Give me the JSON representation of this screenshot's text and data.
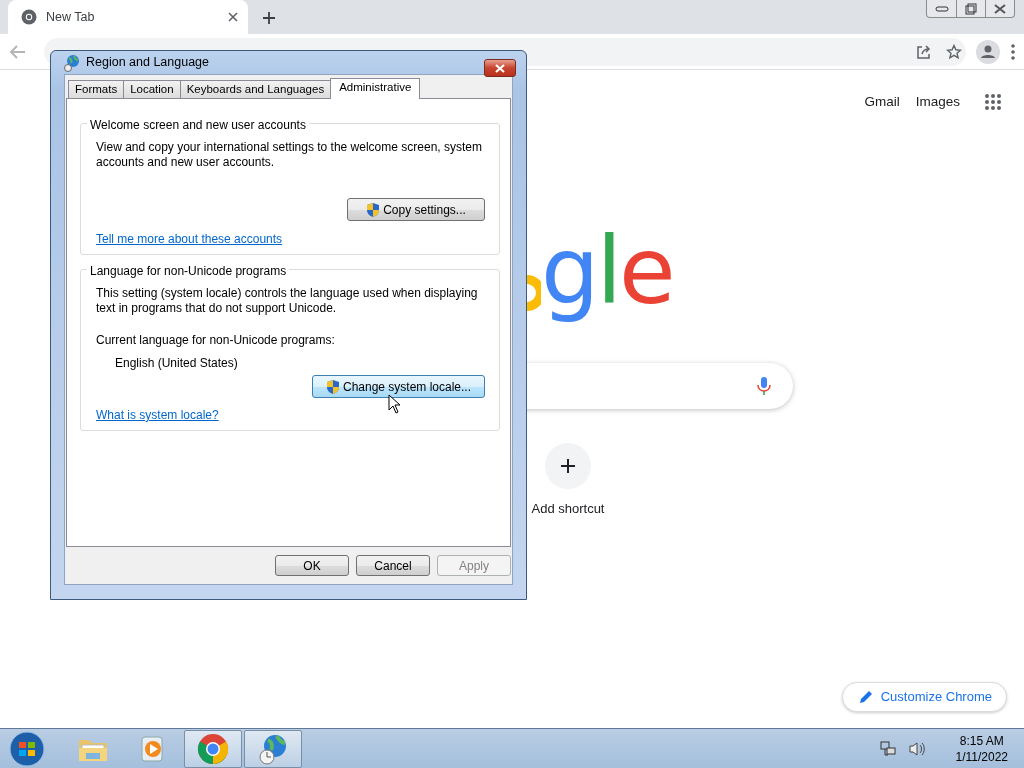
{
  "browser": {
    "tabs": [
      {
        "title": "New Tab",
        "selected": true
      }
    ],
    "top_links": [
      "Gmail",
      "Images"
    ],
    "logo_text": "gle",
    "shortcut": {
      "label": "Add shortcut"
    },
    "customize_button": "Customize Chrome"
  },
  "dialog": {
    "title": "Region and Language",
    "tabs": [
      {
        "label": "Formats",
        "selected": false
      },
      {
        "label": "Location",
        "selected": false
      },
      {
        "label": "Keyboards and Languages",
        "selected": false
      },
      {
        "label": "Administrative",
        "selected": true
      }
    ],
    "groups": [
      {
        "title": "Welcome screen and new user accounts",
        "description": "View and copy your international settings to the welcome screen, system accounts and new user accounts.",
        "button": {
          "label": "Copy settings...",
          "highlighted": false
        },
        "link": "Tell me more about these accounts"
      },
      {
        "title": "Language for non-Unicode programs",
        "description": "This setting (system locale) controls the language used when displaying text in programs that do not support Unicode.",
        "current_label": "Current language for non-Unicode programs:",
        "current_value": "English (United States)",
        "button": {
          "label": "Change system locale...",
          "highlighted": true
        },
        "link": "What is system locale?"
      }
    ],
    "buttons": [
      {
        "label": "OK",
        "disabled": false
      },
      {
        "label": "Cancel",
        "disabled": false
      },
      {
        "label": "Apply",
        "disabled": true
      }
    ]
  },
  "taskbar": {
    "apps": [
      {
        "kind": "explorer",
        "running": false
      },
      {
        "kind": "media",
        "running": false
      },
      {
        "kind": "chrome",
        "running": true
      },
      {
        "kind": "globe",
        "running": true
      }
    ],
    "clock": {
      "time": "8:15 AM",
      "date": "1/11/2022"
    }
  }
}
